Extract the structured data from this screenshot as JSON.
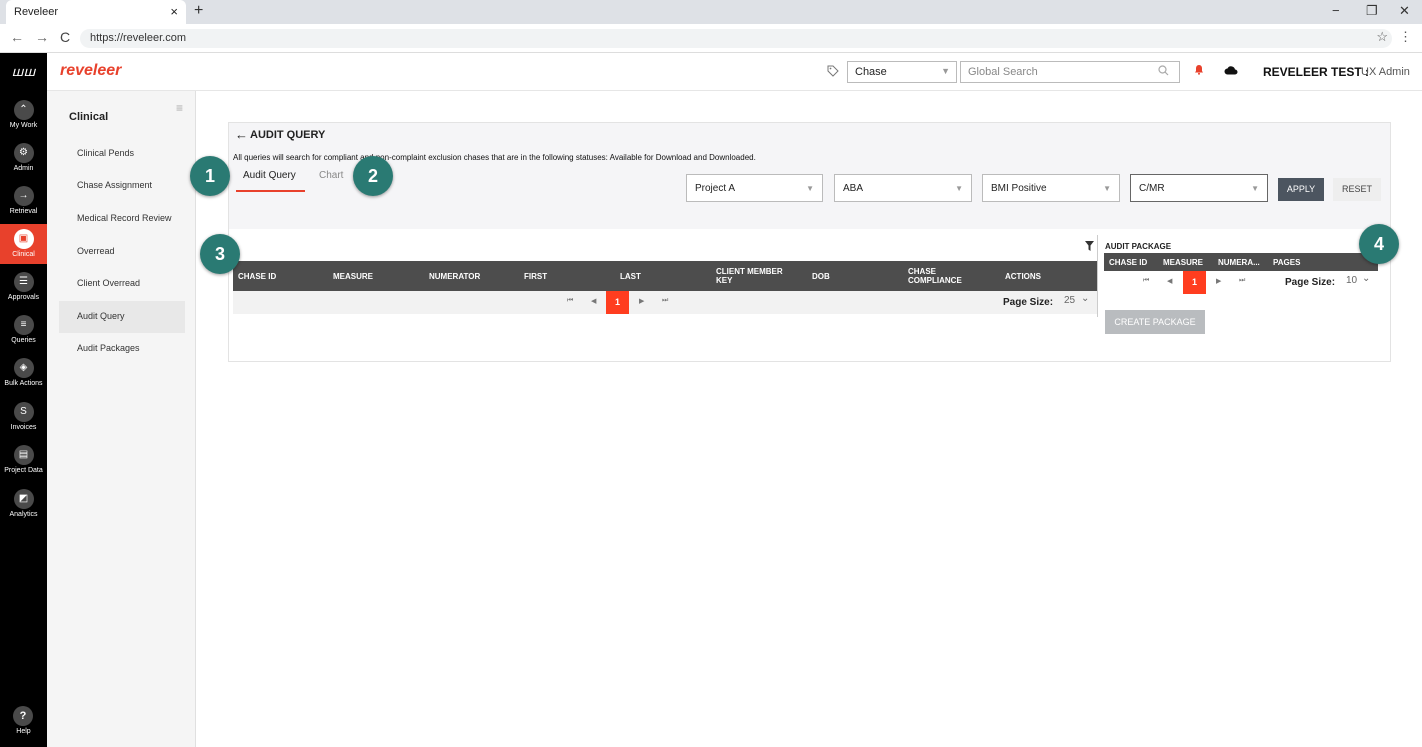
{
  "browser": {
    "tab_title": "Reveleer",
    "tab_close": "×",
    "new_tab": "+",
    "url": "https://reveleer.com",
    "back": "←",
    "forward": "→",
    "reload": "C",
    "star": "☆",
    "menu": "⋮",
    "minimize": "−",
    "restore": "❐",
    "close": "✕"
  },
  "header": {
    "logo_mark": "ꟺꟺ",
    "logo_text": "reveleer",
    "tag_icon": "⌂",
    "chase_select": "Chase",
    "search_placeholder": "Global Search",
    "user_name": "REVELEER TEST :",
    "user_role": "UX Admin"
  },
  "nav": {
    "items": [
      {
        "label": "My Work",
        "icon": "⌃"
      },
      {
        "label": "Admin",
        "icon": "⚙"
      },
      {
        "label": "Retrieval",
        "icon": "→"
      },
      {
        "label": "Clinical",
        "icon": "▣"
      },
      {
        "label": "Approvals",
        "icon": "☰"
      },
      {
        "label": "Queries",
        "icon": "≡"
      },
      {
        "label": "Bulk Actions",
        "icon": "◈"
      },
      {
        "label": "Invoices",
        "icon": "S"
      },
      {
        "label": "Project Data",
        "icon": "▤"
      },
      {
        "label": "Analytics",
        "icon": "◩"
      }
    ],
    "help_label": "Help",
    "help_icon": "?"
  },
  "side": {
    "header": "Clinical",
    "menu_icon": "≡",
    "items": [
      "Clinical Pends",
      "Chase Assignment",
      "Medical Record Review",
      "Overread",
      "Client Overread",
      "Audit Query",
      "Audit Packages"
    ]
  },
  "page": {
    "back_icon": "←",
    "title": "AUDIT QUERY",
    "description": "All queries will search for compliant and non-complaint exclusion chases that are in the following statuses: Available for Download and Downloaded.",
    "tabs": [
      "Audit Query",
      "Chart"
    ],
    "filters": [
      "Project A",
      "ABA",
      "BMI Positive",
      "C/MR"
    ],
    "apply": "APPLY",
    "reset": "RESET"
  },
  "grid": {
    "columns": [
      "CHASE ID",
      "MEASURE",
      "NUMERATOR",
      "FIRST",
      "LAST",
      "CLIENT MEMBER KEY",
      "DOB",
      "CHASE COMPLIANCE",
      "ACTIONS"
    ],
    "pager": {
      "first": "⏮",
      "prev": "◀",
      "current": "1",
      "next": "▶",
      "last": "⏭"
    },
    "page_size_label": "Page Size:",
    "page_size": "25",
    "dropdown": "⌄"
  },
  "audit_package": {
    "title": "AUDIT PACKAGE",
    "columns": [
      "CHASE ID",
      "MEASURE",
      "NUMERA...",
      "PAGES"
    ],
    "current_page": "1",
    "page_size_label": "Page Size:",
    "page_size": "10",
    "create": "CREATE PACKAGE"
  },
  "callouts": [
    "1",
    "2",
    "3",
    "4"
  ],
  "colors": {
    "accent": "#e8412c",
    "callout": "#2a7a73",
    "grid_header": "#4d4d4d"
  }
}
